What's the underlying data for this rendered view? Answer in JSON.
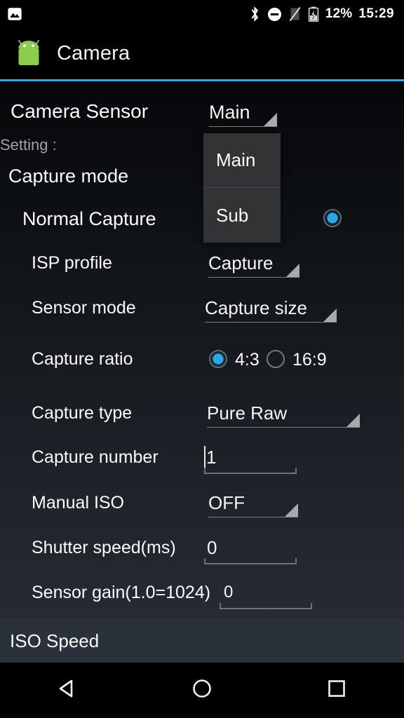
{
  "status_bar": {
    "notification_icon": "photo-icon",
    "icons": [
      "bluetooth-icon",
      "do-not-disturb-icon",
      "signal-off-icon",
      "battery-charging-icon"
    ],
    "battery_percent": "12%",
    "time": "15:29"
  },
  "app_bar": {
    "icon": "android-robot-icon",
    "title": "Camera",
    "accent_color": "#3aa6dd"
  },
  "settings": {
    "camera_sensor": {
      "label": "Camera Sensor",
      "value": "Main",
      "options": [
        "Main",
        "Sub"
      ]
    },
    "setting_label": "Setting :",
    "capture_mode_label": "Capture mode",
    "normal_capture": {
      "label": "Normal Capture",
      "selected": true
    },
    "rows": [
      {
        "label": "ISP profile",
        "type": "spinner",
        "value": "Capture"
      },
      {
        "label": "Sensor mode",
        "type": "spinner",
        "value": "Capture size"
      },
      {
        "label": "Capture type",
        "type": "spinner",
        "value": "Pure Raw"
      },
      {
        "label": "Manual ISO",
        "type": "spinner",
        "value": "OFF"
      }
    ],
    "capture_ratio": {
      "label": "Capture ratio",
      "options": [
        {
          "label": "4:3",
          "selected": true
        },
        {
          "label": "16:9",
          "selected": false
        }
      ]
    },
    "capture_number": {
      "label": "Capture number",
      "value": "1"
    },
    "shutter_speed": {
      "label": "Shutter speed(ms)",
      "value": "0"
    },
    "sensor_gain": {
      "label": "Sensor gain(1.0=1024)",
      "value": "0"
    },
    "iso_speed_label": "ISO Speed",
    "radio_accent": "#2aa8e8"
  },
  "nav_bar": {
    "back": "back-triangle-icon",
    "home": "home-circle-icon",
    "recents": "recents-square-icon"
  }
}
